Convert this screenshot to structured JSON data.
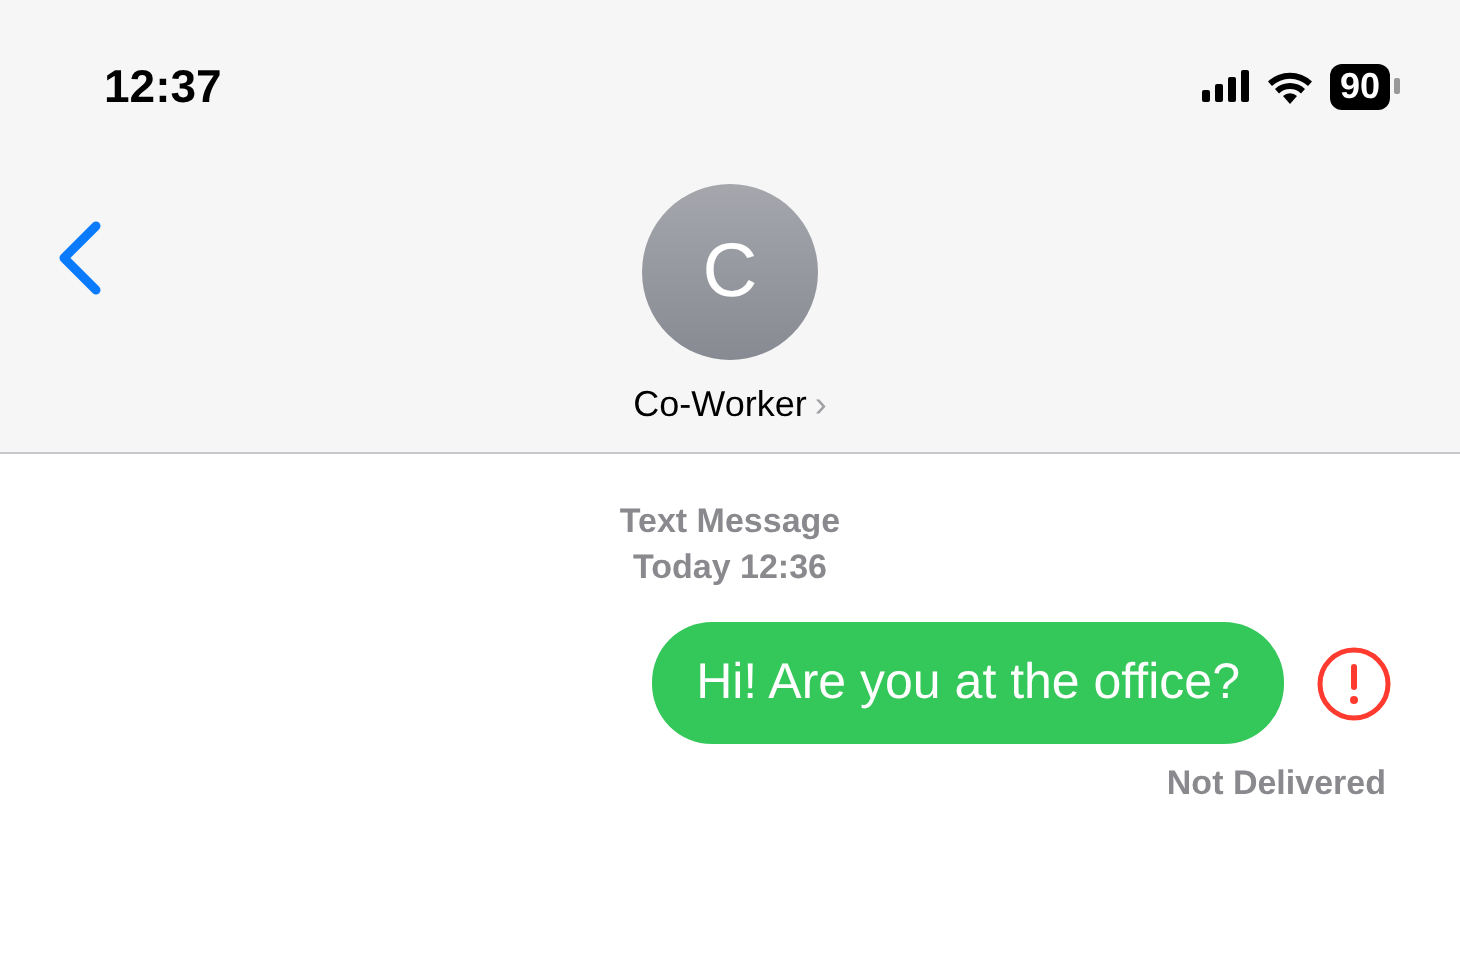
{
  "status_bar": {
    "time": "12:37",
    "battery": "90"
  },
  "header": {
    "avatar_initial": "C",
    "contact_name": "Co-Worker",
    "chevron": "›"
  },
  "conversation": {
    "service": "Text Message",
    "timestamp": "Today 12:36"
  },
  "messages": [
    {
      "text": "Hi! Are you at the office?",
      "outgoing": true,
      "failed": true,
      "status": "Not Delivered"
    }
  ]
}
